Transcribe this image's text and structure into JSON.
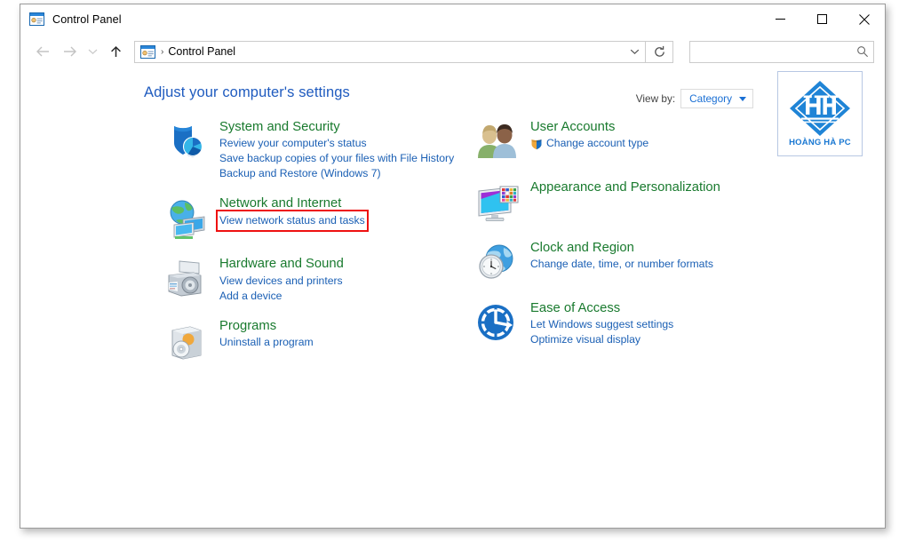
{
  "window": {
    "title": "Control Panel",
    "title_icon": "control-panel-icon",
    "caption": {
      "minimize": "minimize-icon",
      "maximize": "maximize-icon",
      "close": "close-icon"
    }
  },
  "navbar": {
    "back": "back-arrow-icon",
    "forward": "forward-arrow-icon",
    "recent": "chevron-down-icon",
    "up": "up-arrow-icon",
    "address_icon": "control-panel-icon",
    "address_separator": "›",
    "address_text": "Control Panel",
    "address_chevron": "chevron-down-icon",
    "refresh": "refresh-icon",
    "search_value": "",
    "search_placeholder": "",
    "search_icon": "search-icon"
  },
  "main": {
    "heading": "Adjust your computer's settings",
    "view_by": {
      "label": "View by:",
      "value": "Category"
    },
    "logo": {
      "monogram": "HH",
      "text": "HOÀNG HÀ PC",
      "color": "#1877d2"
    },
    "left_column": [
      {
        "icon": "shield-security-icon",
        "title": "System and Security",
        "links": [
          {
            "text": "Review your computer's status",
            "shield": false,
            "highlight": false
          },
          {
            "text": "Save backup copies of your files with File History",
            "shield": false,
            "highlight": false
          },
          {
            "text": "Backup and Restore (Windows 7)",
            "shield": false,
            "highlight": false
          }
        ]
      },
      {
        "icon": "network-globe-icon",
        "title": "Network and Internet",
        "links": [
          {
            "text": "View network status and tasks",
            "shield": false,
            "highlight": true
          }
        ]
      },
      {
        "icon": "printer-hardware-icon",
        "title": "Hardware and Sound",
        "links": [
          {
            "text": "View devices and printers",
            "shield": false,
            "highlight": false
          },
          {
            "text": "Add a device",
            "shield": false,
            "highlight": false
          }
        ]
      },
      {
        "icon": "programs-disc-icon",
        "title": "Programs",
        "links": [
          {
            "text": "Uninstall a program",
            "shield": false,
            "highlight": false
          }
        ]
      }
    ],
    "right_column": [
      {
        "icon": "user-accounts-icon",
        "title": "User Accounts",
        "links": [
          {
            "text": "Change account type",
            "shield": true,
            "highlight": false
          }
        ]
      },
      {
        "icon": "appearance-monitor-icon",
        "title": "Appearance and Personalization",
        "links": []
      },
      {
        "icon": "clock-region-icon",
        "title": "Clock and Region",
        "links": [
          {
            "text": "Change date, time, or number formats",
            "shield": false,
            "highlight": false
          }
        ]
      },
      {
        "icon": "ease-of-access-icon",
        "title": "Ease of Access",
        "links": [
          {
            "text": "Let Windows suggest settings",
            "shield": false,
            "highlight": false
          },
          {
            "text": "Optimize visual display",
            "shield": false,
            "highlight": false
          }
        ]
      }
    ]
  },
  "colors": {
    "heading": "#1f5bbf",
    "category_title": "#197a2e",
    "link": "#1a5fb4",
    "highlight_box": "#ee1111"
  }
}
